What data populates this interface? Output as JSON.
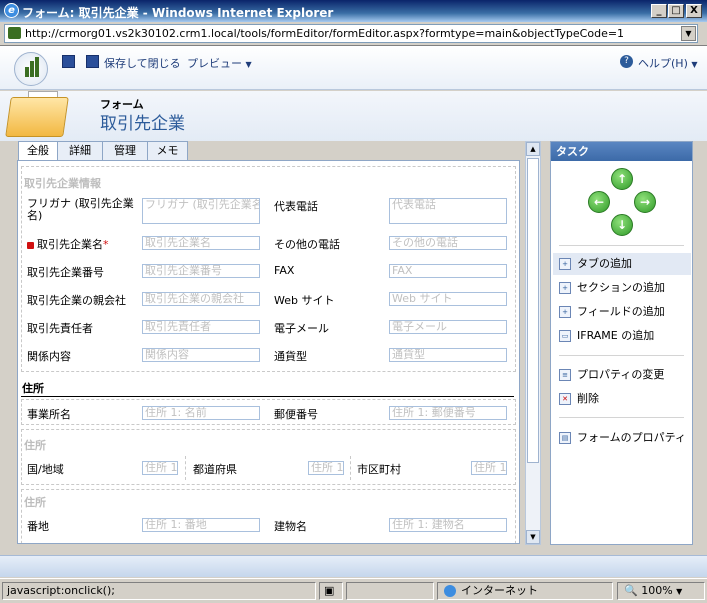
{
  "window": {
    "title": "フォーム: 取引先企業 - Windows Internet Explorer",
    "minimize": "_",
    "maximize": "□",
    "close": "X"
  },
  "address": {
    "url": "http://crmorg01.vs2k30102.crm1.local/tools/formEditor/formEditor.aspx?formtype=main&objectTypeCode=1"
  },
  "toolbar": {
    "save_close": "保存して閉じる",
    "preview": "プレビュー",
    "help": "ヘルプ(H)"
  },
  "header": {
    "subtitle": "フォーム",
    "title": "取引先企業"
  },
  "tabs": [
    {
      "label": "全般"
    },
    {
      "label": "詳細"
    },
    {
      "label": "管理"
    },
    {
      "label": "メモ"
    }
  ],
  "form": {
    "section1": {
      "title": "取引先企業情報",
      "rows": [
        {
          "l1": "フリガナ (取引先企業名)",
          "p1": "フリガナ (取引先企業名)",
          "l2": "代表電話",
          "p2": "代表電話"
        },
        {
          "l1": "取引先企業名",
          "req": "*",
          "p1": "取引先企業名",
          "l2": "その他の電話",
          "p2": "その他の電話"
        },
        {
          "l1": "取引先企業番号",
          "p1": "取引先企業番号",
          "l2": "FAX",
          "p2": "FAX"
        },
        {
          "l1": "取引先企業の親会社",
          "p1": "取引先企業の親会社",
          "l2": "Web サイト",
          "p2": "Web サイト"
        },
        {
          "l1": "取引先責任者",
          "p1": "取引先責任者",
          "l2": "電子メール",
          "p2": "電子メール"
        },
        {
          "l1": "関係内容",
          "p1": "関係内容",
          "l2": "通貨型",
          "p2": "通貨型"
        }
      ]
    },
    "section2": {
      "title": "住所",
      "l1": "事業所名",
      "p1": "住所 1: 名前",
      "l2": "郵便番号",
      "p2": "住所 1: 郵便番号"
    },
    "section3": {
      "title": "住所",
      "l1": "国/地域",
      "p1": "住所 1",
      "l2": "都道府県",
      "p2": "住所 1",
      "l3": "市区町村",
      "p3": "住所 1"
    },
    "section4": {
      "title": "住所",
      "l1": "番地",
      "p1": "住所 1: 番地",
      "l2": "建物名",
      "p2": "住所 1: 建物名"
    }
  },
  "tasks": {
    "title": "タスク",
    "items": [
      {
        "label": "タブの追加"
      },
      {
        "label": "セクションの追加"
      },
      {
        "label": "フィールドの追加"
      },
      {
        "label": "IFRAME の追加"
      },
      {
        "label": "プロパティの変更"
      },
      {
        "label": "削除"
      },
      {
        "label": "フォームのプロパティ"
      }
    ]
  },
  "statusbar": {
    "text": "javascript:onclick();",
    "zone": "インターネット",
    "zoom": "100%"
  }
}
